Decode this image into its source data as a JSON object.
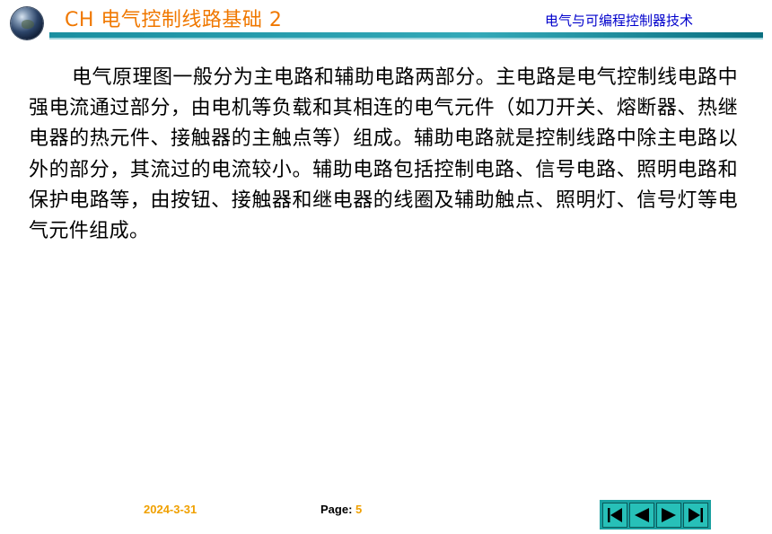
{
  "header": {
    "chapter_title": "CH 电气控制线路基础 2",
    "course_title": "电气与可编程控制器技术"
  },
  "content": {
    "paragraph": "电气原理图一般分为主电路和辅助电路两部分。主电路是电气控制线电路中强电流通过部分，由电机等负载和其相连的电气元件（如刀开关、熔断器、热继电器的热元件、接触器的主触点等）组成。辅助电路就是控制线路中除主电路以外的部分，其流过的电流较小。辅助电路包括控制电路、信号电路、照明电路和保护电路等，由按钮、接触器和继电器的线圈及辅助触点、照明灯、信号灯等电气元件组成。"
  },
  "footer": {
    "date": "2024-3-31",
    "page_label": "Page:",
    "page_number": "5"
  },
  "navigation": {
    "buttons": [
      "first-page-icon",
      "previous-page-icon",
      "next-page-icon",
      "last-page-icon"
    ],
    "color": "#1aa0a0"
  },
  "colors": {
    "title": "#f07800",
    "course_title": "#0000cc",
    "accent_bar": "#1a8fa0",
    "footer_date": "#f0a000"
  }
}
